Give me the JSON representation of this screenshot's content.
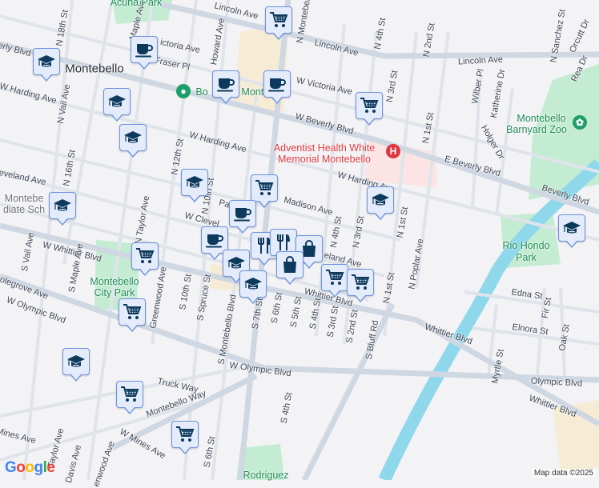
{
  "map": {
    "place_label": "Montebello",
    "streets": [
      "Lincoln Ave",
      "Lincoln Ave",
      "Lincoln Ave",
      "ictoria Ave",
      "W Victoria Ave",
      "erly Blvd",
      "W Beverly Blvd",
      "E Beverly Blvd",
      "Beverly Blvd",
      "W Harding Ave",
      "W Harding Ave",
      "W Harding Ave",
      "eveland Ave",
      "W Clevel",
      "Madison Ave",
      "eland Ave",
      "W Whittier Blvd",
      "Whittier Blvd",
      "Whittier Blvd",
      "Whittier Blvd",
      "olegrove Ave",
      "W Olympic Blvd",
      "W Olympic Blvd",
      "Olympic Blvd",
      "Truck Way",
      "Montebello Way",
      "W Mines Ave",
      "Mines Ave",
      "Edna St",
      "Elnora St",
      "N 18th St",
      "N Vail Ave",
      "N 16th St",
      "N 12th St",
      "N 10th St",
      "N Taylor Ave",
      "S Vail Ave",
      "S Maple Ave",
      "Greenwood Ave",
      "S 10th St",
      "S Spruce St",
      "S Montebello Blvd",
      "S 7th St",
      "S 6th St",
      "S 5th St",
      "S 4th St",
      "S 3rd St",
      "S 2nd St",
      "S Bluff Rd",
      "S 4th St",
      "S 6th St",
      "Howard Ave",
      "N Montebello",
      "N 4th St",
      "N 2nd St",
      "N Sanchez St",
      "Orcutt Dr",
      "Rea Dr",
      "Wilber Pl",
      "Katherine Dr",
      "N 3rd St",
      "N 1st St",
      "Holger Dr",
      "N 4th St",
      "N 3rd St",
      "N 1st St",
      "N Poplar Ave",
      "N 1st St",
      "Myrtle St",
      "Fir St",
      "Oak St",
      "Taylor Ave",
      "Davis Ave",
      "enwood Ave",
      "Maple Ave",
      "Fraser Pl",
      "Pa"
    ],
    "pois": {
      "hospital": [
        "Adventist Health White",
        "Memorial Montebello"
      ],
      "zoo": [
        "Montebello",
        "Barnyard Zoo"
      ],
      "rio_hondo": [
        "Rio Hondo",
        "Park"
      ],
      "city_park": [
        "Montebello",
        "City Park"
      ],
      "acuna": "Acuna Park",
      "school": [
        "Montebe",
        "diate Sch"
      ],
      "botanic_a": "Bo",
      "botanic_b": "Montebello",
      "rodriguez": "Rodriguez"
    },
    "markers": [
      "cart",
      "cup",
      "grad",
      "cup",
      "cup",
      "cart",
      "grad",
      "grad",
      "grad",
      "cart",
      "grad",
      "grad",
      "grad",
      "cup",
      "cup",
      "cart",
      "grad",
      "cutlery",
      "cutlery",
      "bag",
      "bag",
      "cart",
      "cart",
      "grad",
      "cart",
      "grad",
      "cart",
      "cart"
    ],
    "colors": {
      "marker_icon": "#0d3a5c",
      "marker_bg": "#e4ecfb",
      "water": "#8fd8ec",
      "park": "#c4ecd2",
      "hospital": "#fbe4e3",
      "road": "#d4dbe4"
    }
  },
  "footer": {
    "logo": "Google",
    "attribution": "Map data ©2025"
  }
}
